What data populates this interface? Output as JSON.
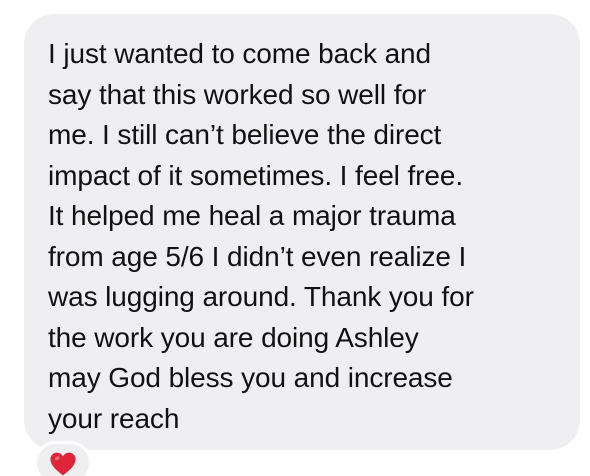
{
  "message": {
    "lines": [
      "I just wanted to come back and",
      "say that this worked so well for",
      "me. I still can’t believe the direct",
      "impact of it sometimes. I feel free.",
      "It helped me heal a major trauma",
      "from age 5/6 I didn’t even realize I",
      "was lugging around. Thank you for",
      "the work you are doing Ashley",
      "may God bless you and increase",
      "your reach"
    ]
  },
  "reaction": {
    "icon": "heart-icon",
    "color": "#e0243a"
  },
  "colors": {
    "bubble": "#efeff2",
    "text": "#111111"
  }
}
